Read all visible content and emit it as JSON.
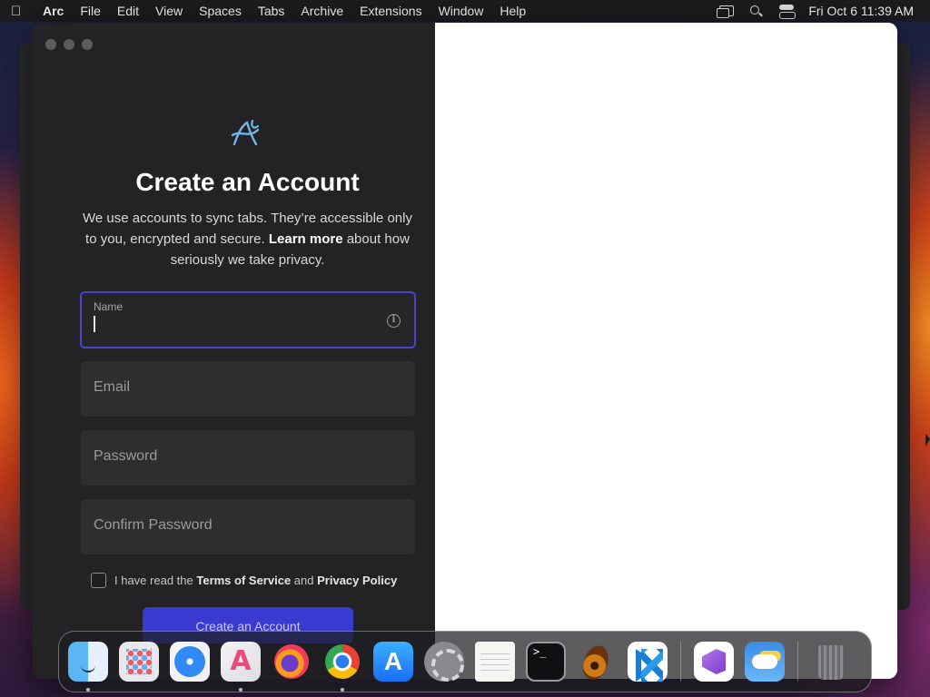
{
  "menubar": {
    "app_name": "Arc",
    "items": [
      "File",
      "Edit",
      "View",
      "Spaces",
      "Tabs",
      "Archive",
      "Extensions",
      "Window",
      "Help"
    ],
    "clock": "Fri Oct 6  11:39 AM",
    "status_icons": [
      "screen-mirroring-icon",
      "spotlight-search-icon",
      "control-center-icon"
    ]
  },
  "signup": {
    "title": "Create an Account",
    "subtitle_part1": "We use accounts to sync tabs. They’re accessible only to you, encrypted and secure. ",
    "subtitle_link": "Learn more",
    "subtitle_part2": " about how seriously we take privacy.",
    "name_label": "Name",
    "name_value": "",
    "email_placeholder": "Email",
    "password_placeholder": "Password",
    "confirm_password_placeholder": "Confirm Password",
    "terms_prefix": "I have read the ",
    "terms_link": "Terms of Service",
    "terms_and": " and ",
    "privacy_link": "Privacy Policy",
    "terms_checked": false,
    "create_button": "Create an Account"
  },
  "dock": {
    "apps": [
      {
        "name": "Finder",
        "icon": "finder-icon",
        "running": true
      },
      {
        "name": "Launchpad",
        "icon": "launchpad-icon",
        "running": false
      },
      {
        "name": "Safari",
        "icon": "safari-icon",
        "running": false
      },
      {
        "name": "Arc",
        "icon": "arc-icon",
        "running": true
      },
      {
        "name": "Firefox",
        "icon": "firefox-icon",
        "running": false
      },
      {
        "name": "Google Chrome",
        "icon": "chrome-icon",
        "running": true
      },
      {
        "name": "App Store",
        "icon": "app-store-icon",
        "running": false
      },
      {
        "name": "System Settings",
        "icon": "system-settings-icon",
        "running": false
      },
      {
        "name": "TextEdit",
        "icon": "textedit-icon",
        "running": false
      },
      {
        "name": "Terminal",
        "icon": "terminal-icon",
        "running": false
      },
      {
        "name": "GarageBand",
        "icon": "garageband-icon",
        "running": false
      },
      {
        "name": "Visual Studio Code",
        "icon": "vscode-icon",
        "running": false
      }
    ],
    "recent": [
      {
        "name": "Visual Studio",
        "icon": "visual-studio-icon"
      },
      {
        "name": "Weather",
        "icon": "weather-icon"
      }
    ],
    "trash": {
      "name": "Trash",
      "icon": "trash-icon"
    }
  },
  "colors": {
    "accent": "#4a44c8",
    "button": "#3a3ad0",
    "pane_bg": "#232325"
  }
}
